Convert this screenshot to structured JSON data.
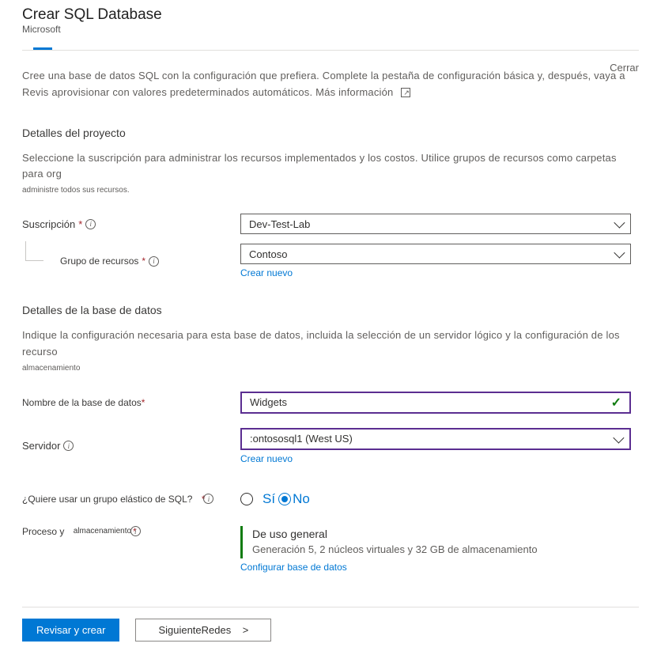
{
  "header": {
    "title": "Crear SQL Database",
    "subtitle": "Microsoft",
    "topRightLink": "Cerrar"
  },
  "intro": {
    "text": "Cree una base de datos SQL con la configuración que prefiera. Complete la pestaña de configuración básica y, después, vaya a Revis aprovisionar con valores predeterminados automáticos.",
    "moreInfo": "Más información"
  },
  "project": {
    "heading": "Detalles del proyecto",
    "desc": "Seleccione la suscripción para administrar los recursos implementados y los costos. Utilice grupos de recursos como carpetas para org",
    "note": "administre todos sus recursos.",
    "subscriptionLabel": "Suscripción",
    "subscriptionValue": "Dev-Test-Lab",
    "rgLabel": "Grupo de recursos",
    "rgValue": "Contoso",
    "createNew": "Crear nuevo"
  },
  "database": {
    "heading": "Detalles de la base de datos",
    "desc": "Indique la configuración necesaria para esta base de datos, incluida la selección de un servidor lógico y la configuración de los recurso",
    "note": "almacenamiento",
    "nameLabel": "Nombre de la base de datos",
    "nameValue": "Widgets",
    "serverLabel": "Servidor",
    "serverValue": ":ontososql1 (West US)",
    "createNew": "Crear nuevo",
    "elasticLabel": "¿Quiere usar un grupo elástico de SQL?",
    "radioYes": "Sí",
    "radioNo": "No",
    "computeLabel1": "Proceso y",
    "computeLabel2": "almacenamiento",
    "computeTitle": "De uso general",
    "computeSub": "Generación 5, 2 núcleos virtuales y 32 GB de almacenamiento",
    "configureLink": "Configurar base de datos"
  },
  "footer": {
    "review": "Revisar y",
    "create": "crear",
    "next": "Siguiente",
    "nextTab": "Redes",
    "arrow": ">"
  }
}
